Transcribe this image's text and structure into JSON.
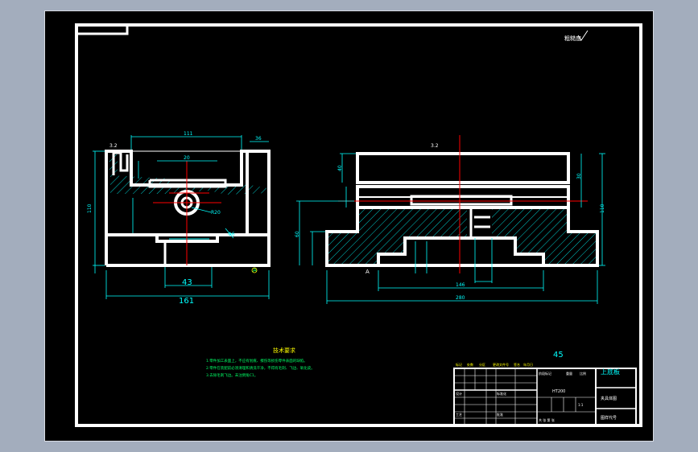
{
  "drawing": {
    "roughness_note": "粗糙度",
    "roughness_symbol": "3.2",
    "tech_req_title": "技术要求",
    "tech_req_lines": [
      "1.零件加工表面上，不应有划痕、擦伤等损伤零件表面的缺陷。",
      "2.零件在装配前必须清理和清洗干净，不得有毛刺、飞边、氧化皮。",
      "3.去除毛刺飞边。未注倒角C1。"
    ],
    "dims_front": {
      "width_label": "161",
      "bore_label": "43",
      "top_label": "111",
      "tab_label": "36",
      "depth_label": "20",
      "height_label": "110",
      "r_label": "R20",
      "hole_label": "Φ6",
      "section_label": "A"
    },
    "dims_side": {
      "total_label": "280",
      "inner_label": "146",
      "height_label": "110",
      "left_label": "60",
      "small_label": "40",
      "mid_label": "30",
      "section_label": "A"
    },
    "scale_number": "45",
    "title_block": {
      "part_name": "上底板",
      "row_labels": [
        "标记",
        "处数",
        "分区",
        "更改文件号",
        "签名",
        "年月日"
      ],
      "design": "设计",
      "std": "标准化",
      "process": "工艺",
      "approve": "批准",
      "stage": "阶段标记",
      "weight": "重量",
      "scale": "比例",
      "scale_value": "1:1",
      "material": "HT200",
      "sheet": "共 张 第 张",
      "name_box": "夹具体图",
      "drawing_no": "图样代号"
    }
  }
}
